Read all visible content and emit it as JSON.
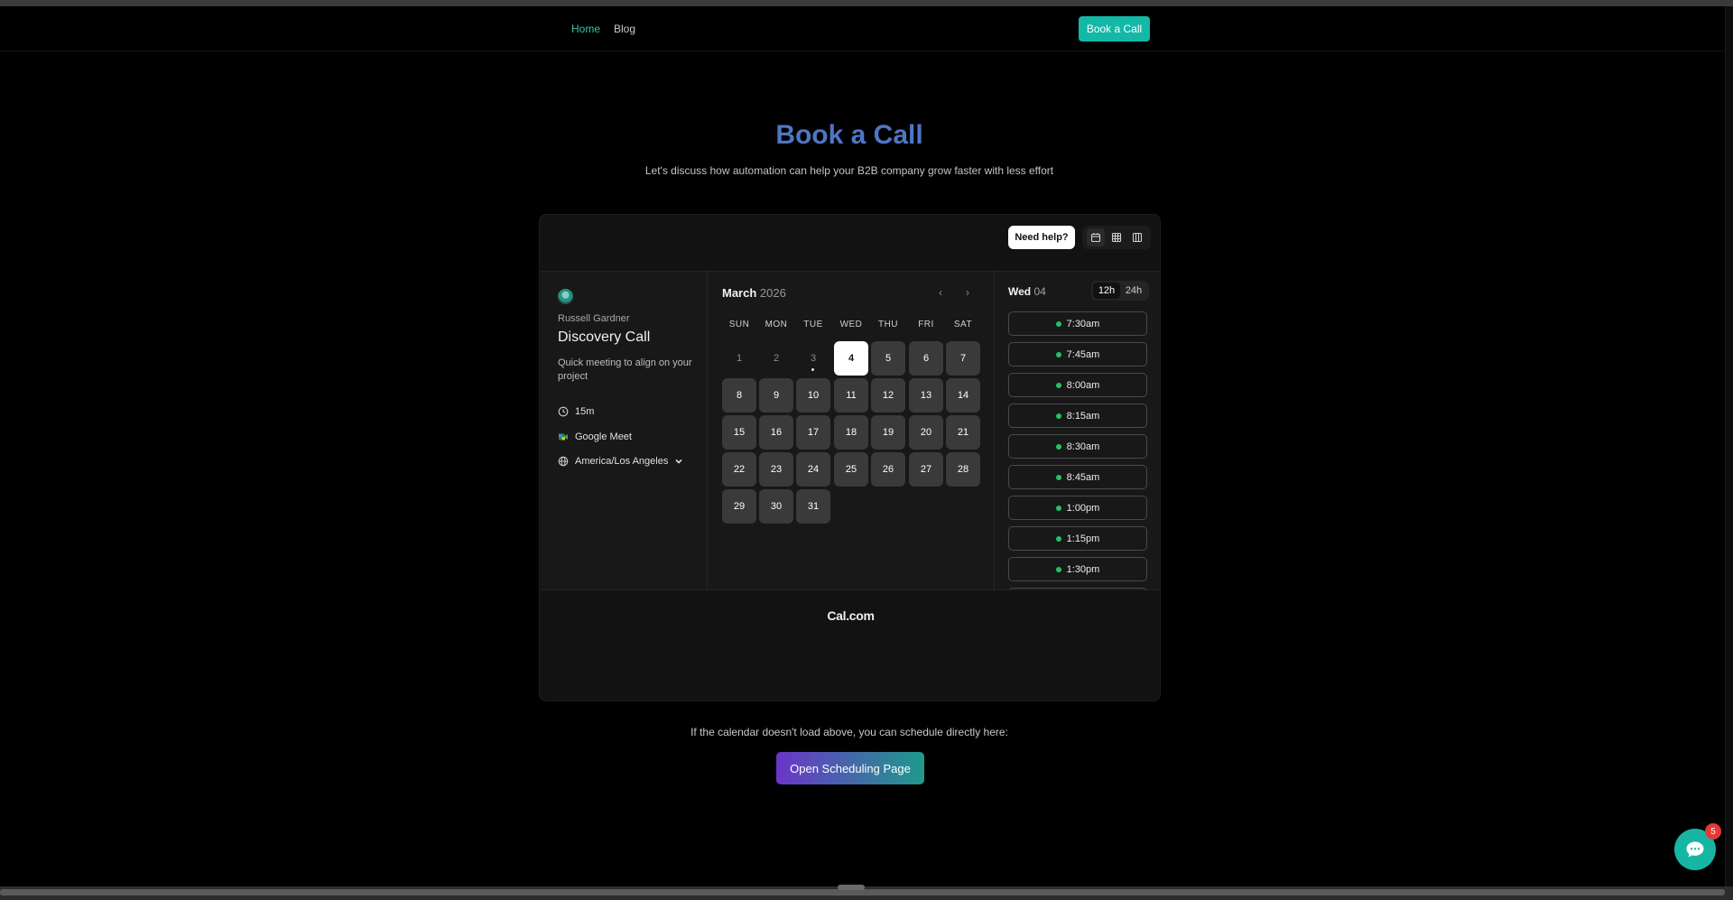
{
  "nav": {
    "links": [
      {
        "label": "Home",
        "active": true
      },
      {
        "label": "Blog",
        "active": false
      }
    ],
    "cta": "Book a Call"
  },
  "hero": {
    "title": "Book a Call",
    "subtitle": "Let's discuss how automation can help your B2B company grow faster with less effort"
  },
  "embed": {
    "help": "Need help?",
    "views": [
      {
        "icon": "calendar-month-icon",
        "selected": true
      },
      {
        "icon": "grid-week-icon",
        "selected": false
      },
      {
        "icon": "columns-view-icon",
        "selected": false
      }
    ],
    "event": {
      "host": "Russell Gardner",
      "title": "Discovery Call",
      "description": "Quick meeting to align on your project",
      "duration": "15m",
      "location": "Google Meet",
      "timezone": "America/Los Angeles"
    },
    "calendar": {
      "month": "March",
      "year": "2026",
      "weekdays": [
        "SUN",
        "MON",
        "TUE",
        "WED",
        "THU",
        "FRI",
        "SAT"
      ],
      "first_weekday_index": 0,
      "days_in_month": 31,
      "past_days": [
        1,
        2,
        3
      ],
      "today": 3,
      "selected": 4
    },
    "times": {
      "day_label": "Wed",
      "day_num": "04",
      "formats": [
        "12h",
        "24h"
      ],
      "active_format": "12h",
      "slots": [
        "7:30am",
        "7:45am",
        "8:00am",
        "8:15am",
        "8:30am",
        "8:45am",
        "1:00pm",
        "1:15pm",
        "1:30pm"
      ]
    },
    "brand": "Cal.com"
  },
  "fallback": {
    "text": "If the calendar doesn't load above, you can schedule directly here:",
    "button": "Open Scheduling Page"
  },
  "chat": {
    "badge": "5"
  },
  "colors": {
    "accent": "#14b8a6",
    "title": "#4f76c5",
    "available": "#22c55e"
  }
}
